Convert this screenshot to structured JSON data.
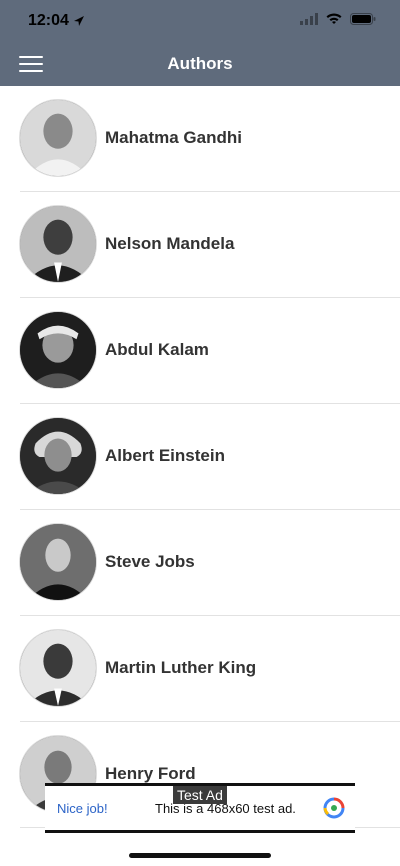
{
  "status_bar": {
    "time": "12:04"
  },
  "header": {
    "title": "Authors",
    "menu_icon": "hamburger-menu-icon"
  },
  "authors": [
    {
      "name": "Mahatma Gandhi"
    },
    {
      "name": "Nelson Mandela"
    },
    {
      "name": "Abdul Kalam"
    },
    {
      "name": "Albert Einstein"
    },
    {
      "name": "Steve Jobs"
    },
    {
      "name": "Martin Luther King"
    },
    {
      "name": "Henry Ford"
    }
  ],
  "ad": {
    "badge": "Test Ad",
    "left_label": "Nice job!",
    "message": "This is a 468x60 test ad."
  },
  "colors": {
    "header_bg": "#5f6b7c",
    "ad_link": "#2b63c7"
  }
}
